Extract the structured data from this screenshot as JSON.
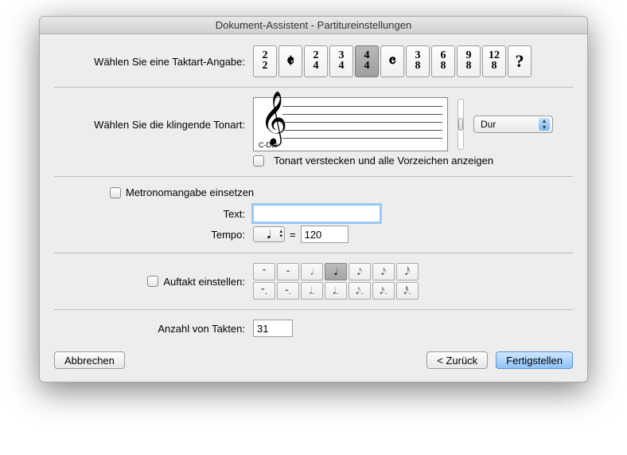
{
  "window": {
    "title": "Dokument-Assistent - Partitureinstellungen"
  },
  "timesig": {
    "label": "Wählen Sie eine Taktart-Angabe:",
    "options": [
      {
        "top": "2",
        "bot": "2"
      },
      {
        "sym": "𝄵"
      },
      {
        "top": "2",
        "bot": "4"
      },
      {
        "top": "3",
        "bot": "4"
      },
      {
        "top": "4",
        "bot": "4"
      },
      {
        "sym": "𝄴"
      },
      {
        "top": "3",
        "bot": "8"
      },
      {
        "top": "6",
        "bot": "8"
      },
      {
        "top": "9",
        "bot": "8"
      },
      {
        "top": "12",
        "bot": "8"
      },
      {
        "sym": "?"
      }
    ],
    "selected_index": 4
  },
  "key": {
    "label": "Wählen Sie die klingende Tonart:",
    "name": "C-Dur",
    "mode_value": "Dur",
    "hide_label": "Tonart verstecken und alle Vorzeichen anzeigen",
    "hide_checked": false
  },
  "metronome": {
    "use_label": "Metronomangabe einsetzen",
    "use_checked": false,
    "text_label": "Text:",
    "text_value": "",
    "tempo_label": "Tempo:",
    "tempo_note": "𝅘𝅥",
    "equals": "=",
    "tempo_value": "120"
  },
  "pickup": {
    "label": "Auftakt einstellen:",
    "checked": false,
    "row1": [
      "𝄻",
      "𝄼",
      "𝅗𝅥",
      "𝅘𝅥",
      "𝅘𝅥𝅮",
      "𝅘𝅥𝅯",
      "𝅘𝅥𝅰"
    ],
    "row2": [
      "𝄻.",
      "𝄼.",
      "𝅗𝅥.",
      "𝅘𝅥.",
      "𝅘𝅥𝅮.",
      "𝅘𝅥𝅯.",
      "𝅘𝅥𝅰."
    ],
    "selected": 3
  },
  "bars": {
    "label": "Anzahl von Takten:",
    "value": "31"
  },
  "buttons": {
    "cancel": "Abbrechen",
    "back": "< Zurück",
    "finish": "Fertigstellen"
  }
}
